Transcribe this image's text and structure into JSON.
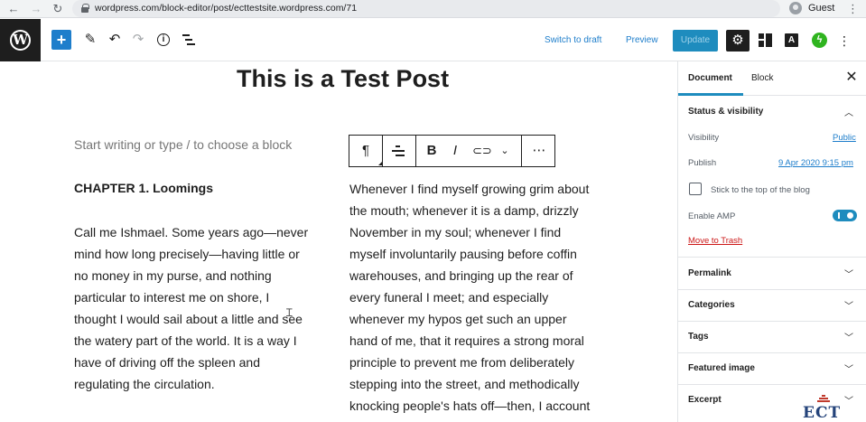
{
  "browser": {
    "back_icon": "arrow-left",
    "forward_icon": "arrow-right",
    "reload_icon": "reload",
    "url": "wordpress.com/block-editor/post/ecttestsite.wordpress.com/71",
    "profile_label": "Guest"
  },
  "toolbar": {
    "logo_letter": "W",
    "add_block_label": "+",
    "switch_to_draft": "Switch to draft",
    "preview": "Preview",
    "update": "Update",
    "accent_color": "#1e8cbe"
  },
  "editor": {
    "title": "This is a Test Post",
    "placeholder": "Start writing or type / to choose a block",
    "chapter_heading": "CHAPTER 1. Loomings",
    "left_paragraph": [
      "Call me Ishmael. Some years ago—never",
      "mind how long precisely—having little or",
      "no money in my purse, and nothing",
      "particular to interest me on shore, I",
      "thought I would sail about a little and see",
      "the watery part of the world. It is a way I",
      "have of driving off the spleen and",
      "regulating the circulation."
    ],
    "right_paragraph": [
      "Whenever I find myself growing grim about",
      "the mouth; whenever it is a damp, drizzly",
      "November in my soul; whenever I find",
      "myself involuntarily pausing before coffin",
      "warehouses, and bringing up the rear of",
      "every funeral I meet; and especially",
      "whenever my hypos get such an upper",
      "hand of me, that it requires a strong moral",
      "principle to prevent me from deliberately",
      "stepping into the street, and methodically",
      "knocking people's hats off—then, I account"
    ],
    "block_toolbar": {
      "paragraph_icon": "¶",
      "bold": "B",
      "italic": "I",
      "more": "⋯"
    }
  },
  "sidebar": {
    "tab_document": "Document",
    "tab_block": "Block",
    "status_visibility": "Status & visibility",
    "visibility_label": "Visibility",
    "visibility_value": "Public",
    "publish_label": "Publish",
    "publish_value": "9 Apr 2020 9:15 pm",
    "sticky_label": "Stick to the top of the blog",
    "amp_label": "Enable AMP",
    "amp_enabled": true,
    "trash": "Move to Trash",
    "sections": [
      "Permalink",
      "Categories",
      "Tags",
      "Featured image",
      "Excerpt"
    ]
  },
  "watermark": {
    "text": "ECT"
  }
}
